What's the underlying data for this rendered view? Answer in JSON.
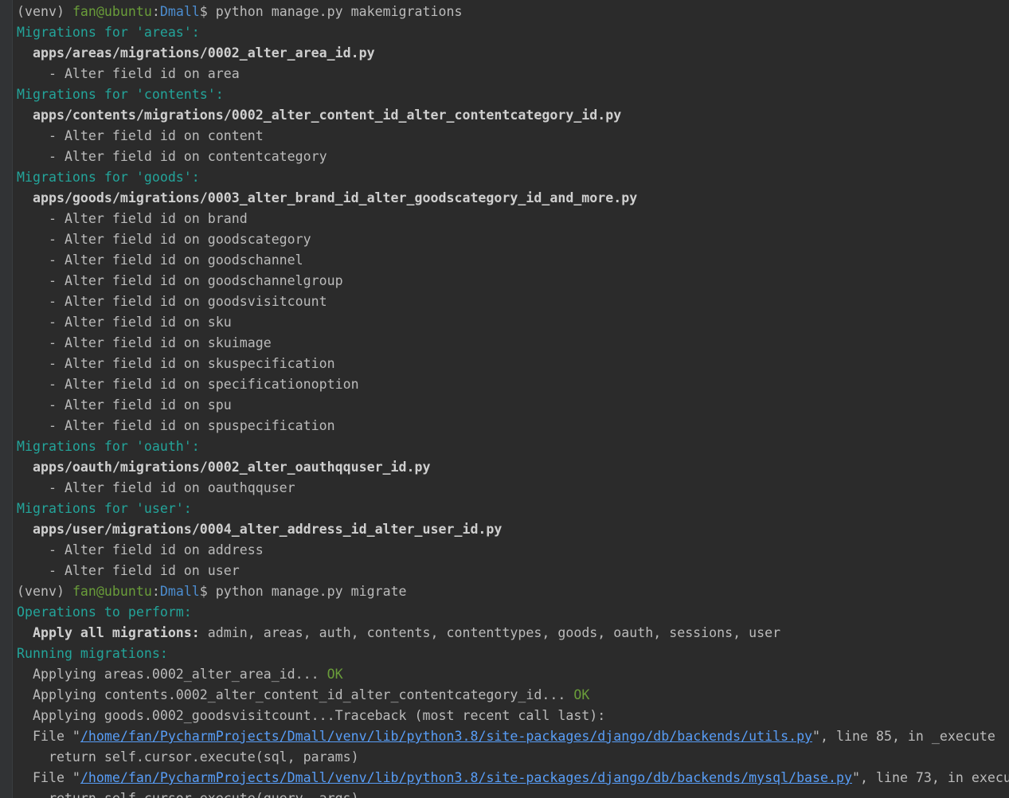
{
  "colors": {
    "background": "#2b2b2b",
    "gutter": "#313335",
    "text": "#bbbbbb",
    "user_host": "#6a9d3a",
    "directory": "#4c8dd0",
    "section_header": "#23a49a",
    "ok": "#6a9d3a",
    "link": "#589df6"
  },
  "lines": [
    [
      {
        "t": "(venv) ",
        "s": "plain"
      },
      {
        "t": "fan@ubuntu",
        "s": "user"
      },
      {
        "t": ":",
        "s": "plain"
      },
      {
        "t": "Dmall",
        "s": "dir"
      },
      {
        "t": "$ python manage.py makemigrations",
        "s": "plain"
      }
    ],
    [
      {
        "t": "Migrations for 'areas':",
        "s": "hdr"
      }
    ],
    [
      {
        "t": "  apps/areas/migrations/0002_alter_area_id.py",
        "s": "bold"
      }
    ],
    [
      {
        "t": "    - Alter field id on area",
        "s": "plain"
      }
    ],
    [
      {
        "t": "Migrations for 'contents':",
        "s": "hdr"
      }
    ],
    [
      {
        "t": "  apps/contents/migrations/0002_alter_content_id_alter_contentcategory_id.py",
        "s": "bold"
      }
    ],
    [
      {
        "t": "    - Alter field id on content",
        "s": "plain"
      }
    ],
    [
      {
        "t": "    - Alter field id on contentcategory",
        "s": "plain"
      }
    ],
    [
      {
        "t": "Migrations for 'goods':",
        "s": "hdr"
      }
    ],
    [
      {
        "t": "  apps/goods/migrations/0003_alter_brand_id_alter_goodscategory_id_and_more.py",
        "s": "bold"
      }
    ],
    [
      {
        "t": "    - Alter field id on brand",
        "s": "plain"
      }
    ],
    [
      {
        "t": "    - Alter field id on goodscategory",
        "s": "plain"
      }
    ],
    [
      {
        "t": "    - Alter field id on goodschannel",
        "s": "plain"
      }
    ],
    [
      {
        "t": "    - Alter field id on goodschannelgroup",
        "s": "plain"
      }
    ],
    [
      {
        "t": "    - Alter field id on goodsvisitcount",
        "s": "plain"
      }
    ],
    [
      {
        "t": "    - Alter field id on sku",
        "s": "plain"
      }
    ],
    [
      {
        "t": "    - Alter field id on skuimage",
        "s": "plain"
      }
    ],
    [
      {
        "t": "    - Alter field id on skuspecification",
        "s": "plain"
      }
    ],
    [
      {
        "t": "    - Alter field id on specificationoption",
        "s": "plain"
      }
    ],
    [
      {
        "t": "    - Alter field id on spu",
        "s": "plain"
      }
    ],
    [
      {
        "t": "    - Alter field id on spuspecification",
        "s": "plain"
      }
    ],
    [
      {
        "t": "Migrations for 'oauth':",
        "s": "hdr"
      }
    ],
    [
      {
        "t": "  apps/oauth/migrations/0002_alter_oauthqquser_id.py",
        "s": "bold"
      }
    ],
    [
      {
        "t": "    - Alter field id on oauthqquser",
        "s": "plain"
      }
    ],
    [
      {
        "t": "Migrations for 'user':",
        "s": "hdr"
      }
    ],
    [
      {
        "t": "  apps/user/migrations/0004_alter_address_id_alter_user_id.py",
        "s": "bold"
      }
    ],
    [
      {
        "t": "    - Alter field id on address",
        "s": "plain"
      }
    ],
    [
      {
        "t": "    - Alter field id on user",
        "s": "plain"
      }
    ],
    [
      {
        "t": "(venv) ",
        "s": "plain"
      },
      {
        "t": "fan@ubuntu",
        "s": "user"
      },
      {
        "t": ":",
        "s": "plain"
      },
      {
        "t": "Dmall",
        "s": "dir"
      },
      {
        "t": "$ python manage.py migrate",
        "s": "plain"
      }
    ],
    [
      {
        "t": "Operations to perform:",
        "s": "hdr"
      }
    ],
    [
      {
        "t": "  Apply all migrations:",
        "s": "bold"
      },
      {
        "t": " admin, areas, auth, contents, contenttypes, goods, oauth, sessions, user",
        "s": "plain"
      }
    ],
    [
      {
        "t": "Running migrations:",
        "s": "hdr"
      }
    ],
    [
      {
        "t": "  Applying areas.0002_alter_area_id... ",
        "s": "plain"
      },
      {
        "t": "OK",
        "s": "ok"
      }
    ],
    [
      {
        "t": "  Applying contents.0002_alter_content_id_alter_contentcategory_id... ",
        "s": "plain"
      },
      {
        "t": "OK",
        "s": "ok"
      }
    ],
    [
      {
        "t": "  Applying goods.0002_goodsvisitcount...Traceback (most recent call last):",
        "s": "plain"
      }
    ],
    [
      {
        "t": "  File \"",
        "s": "plain"
      },
      {
        "t": "/home/fan/PycharmProjects/Dmall/venv/lib/python3.8/site-packages/django/db/backends/utils.py",
        "s": "link"
      },
      {
        "t": "\", line 85, in _execute",
        "s": "plain"
      }
    ],
    [
      {
        "t": "    return self.cursor.execute(sql, params)",
        "s": "plain"
      }
    ],
    [
      {
        "t": "  File \"",
        "s": "plain"
      },
      {
        "t": "/home/fan/PycharmProjects/Dmall/venv/lib/python3.8/site-packages/django/db/backends/mysql/base.py",
        "s": "link"
      },
      {
        "t": "\", line 73, in execu",
        "s": "plain"
      }
    ],
    [
      {
        "t": "    return self.cursor.execute(query, args)",
        "s": "plain"
      }
    ]
  ]
}
